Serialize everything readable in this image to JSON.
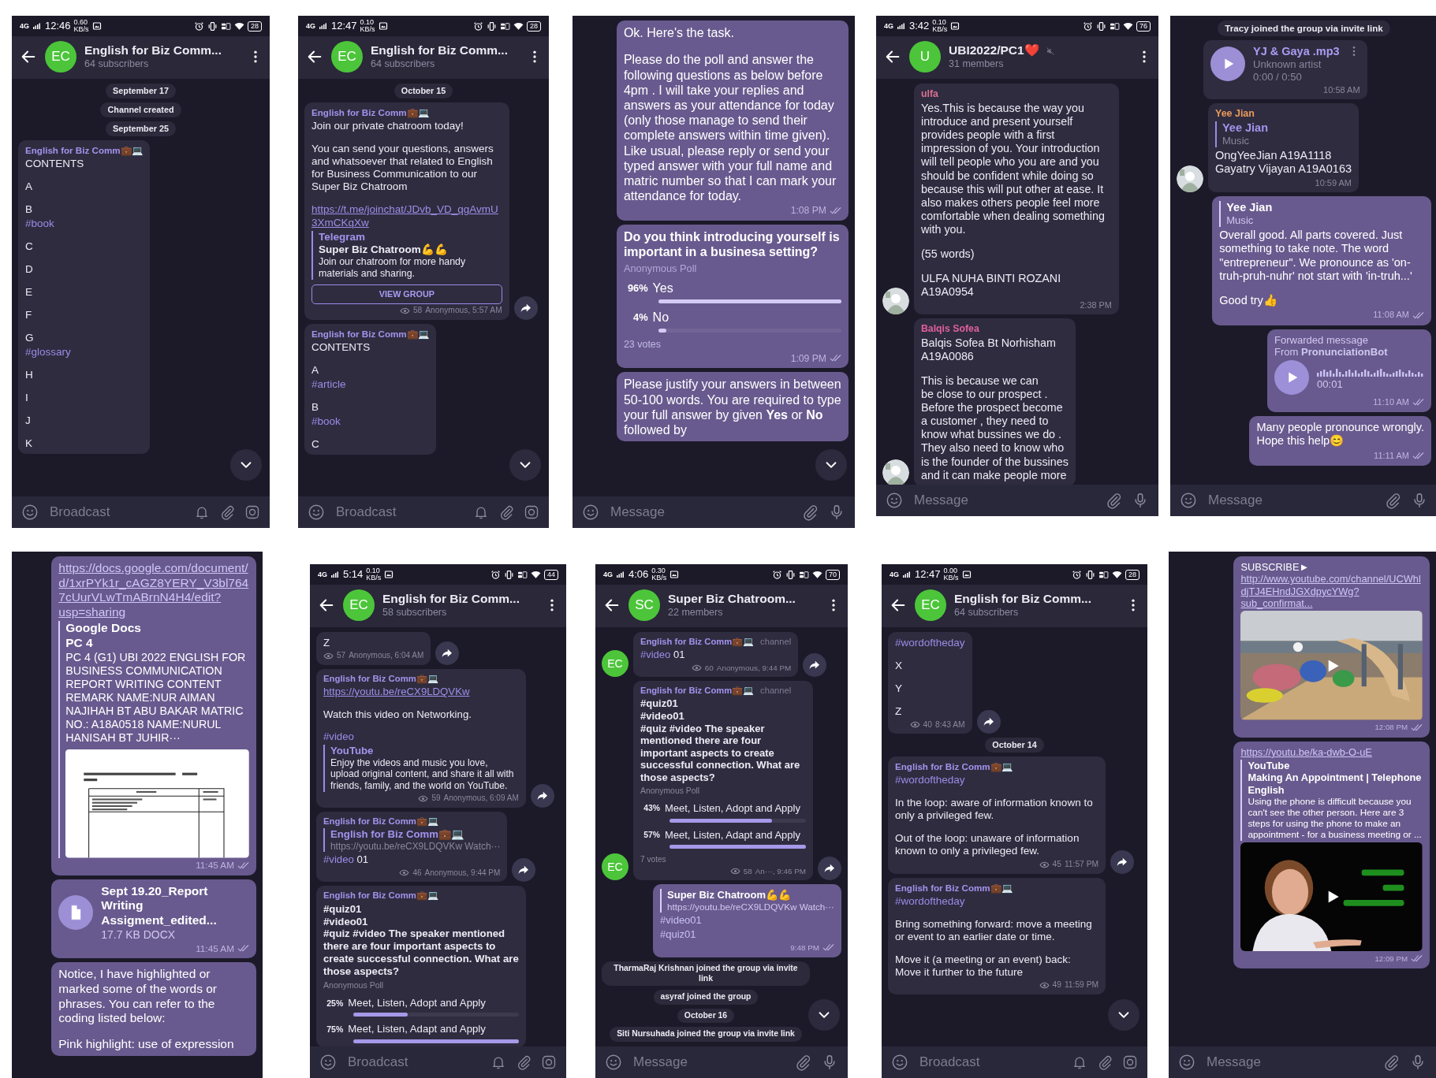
{
  "panels": [
    {
      "status_bar": {
        "network": "4G",
        "time": "12:46",
        "speed": "0.60",
        "speed_unit": "KB/s",
        "battery": "28"
      },
      "header": {
        "avatar": "EC",
        "title": "English for Biz Comm...",
        "subtitle": "64 subscribers"
      },
      "messages": [
        {
          "kind": "service",
          "text": "September 17"
        },
        {
          "kind": "service",
          "text": "Channel created"
        },
        {
          "kind": "service",
          "text": "September 25"
        },
        {
          "kind": "bubble",
          "outgoing": false,
          "author": {
            "name": "English for Biz Comm💼💻",
            "color": "#a393eb"
          },
          "blocks": [
            {
              "kind": "text",
              "text": "CONTENTS"
            },
            {
              "kind": "text",
              "text": "A"
            },
            {
              "kind": "text",
              "text": "B"
            },
            {
              "kind": "tag",
              "text": "#book",
              "joined": true
            },
            {
              "kind": "text",
              "text": "C"
            },
            {
              "kind": "text",
              "text": "D"
            },
            {
              "kind": "text",
              "text": "E"
            },
            {
              "kind": "text",
              "text": "F"
            },
            {
              "kind": "text",
              "text": "G"
            },
            {
              "kind": "tag",
              "text": "#glossary",
              "joined": true
            },
            {
              "kind": "text",
              "text": "H"
            },
            {
              "kind": "text",
              "text": "I"
            },
            {
              "kind": "text",
              "text": "J"
            },
            {
              "kind": "text",
              "text": "K"
            }
          ]
        }
      ],
      "scroll_down": true,
      "composer": {
        "kind": "channel",
        "placeholder": "Broadcast"
      }
    },
    {
      "status_bar": {
        "network": "4G",
        "time": "12:47",
        "speed": "0.10",
        "speed_unit": "KB/s",
        "battery": "28"
      },
      "header": {
        "avatar": "EC",
        "title": "English for Biz Comm...",
        "subtitle": "64 subscribers"
      },
      "messages": [
        {
          "kind": "service",
          "text": "October 15"
        },
        {
          "kind": "bubble",
          "outgoing": false,
          "share": true,
          "author": {
            "name": "English for Biz Comm💼💻",
            "color": "#a393eb"
          },
          "blocks": [
            {
              "kind": "text",
              "text": "Join our private chatroom today!"
            },
            {
              "kind": "text",
              "text": "You can send your questions, answers and whatsoever that related to English for Business Communication to our Super Biz Chatroom"
            },
            {
              "kind": "link",
              "text": "https://t.me/joinchat/JDvb_VD_qgAvmU3XmCKqXw"
            },
            {
              "kind": "preview",
              "site": "Telegram",
              "title": "Super Biz Chatroom💪💪",
              "text": "Join our chatroom for more handy materials and sharing.",
              "joined": true
            },
            {
              "kind": "button",
              "text": "VIEW GROUP",
              "joined": true
            }
          ],
          "meta": {
            "views": "58",
            "text": "Anonymous, 5:57 AM"
          }
        },
        {
          "kind": "bubble",
          "outgoing": false,
          "author": {
            "name": "English for Biz Comm💼💻",
            "color": "#a393eb"
          },
          "blocks": [
            {
              "kind": "text",
              "text": "CONTENTS"
            },
            {
              "kind": "text",
              "text": "A"
            },
            {
              "kind": "tag",
              "text": "#article",
              "joined": true
            },
            {
              "kind": "text",
              "text": "B"
            },
            {
              "kind": "tag",
              "text": "#book",
              "joined": true
            },
            {
              "kind": "text",
              "text": "C"
            }
          ]
        }
      ],
      "scroll_down": true,
      "composer": {
        "kind": "channel",
        "placeholder": "Broadcast"
      }
    },
    {
      "messages": [
        {
          "kind": "bubble",
          "outgoing": true,
          "blocks": [
            {
              "kind": "text",
              "text": "Ok. Here's the task."
            },
            {
              "kind": "text",
              "text": "Please do the poll and answer the following questions as below before 4pm . I will take your replies and answers as your attendance for today (only those manage to send their complete answers within time given). Like usual, please reply or send your typed answer with your full name and matric number so that I can mark your attendance for today."
            }
          ],
          "meta": {
            "text": "1:08 PM",
            "read": true
          }
        },
        {
          "kind": "bubble",
          "outgoing": true,
          "blocks": [
            {
              "kind": "poll",
              "question": "Do you think introducing yourself is important in a businesa setting?",
              "type": "Anonymous Poll",
              "options": [
                {
                  "percent": "96%",
                  "label": "Yes",
                  "level": 1
                },
                {
                  "percent": "4%",
                  "label": "No",
                  "level": 0.04
                }
              ],
              "votes": "23 votes"
            }
          ],
          "meta": {
            "text": "1:09 PM",
            "read": true
          }
        },
        {
          "kind": "bubble",
          "outgoing": true,
          "blocks": [
            {
              "kind": "text",
              "text": "Please justify your answers in between 50-100 words. You are required to type your full answer by given **Yes** or **No** followed by"
            }
          ]
        }
      ],
      "scroll_down": true,
      "composer": {
        "kind": "group",
        "placeholder": "Message"
      }
    },
    {
      "status_bar": {
        "network": "4G",
        "time": "3:42",
        "speed": "0.10",
        "speed_unit": "KB/s",
        "battery": "76"
      },
      "header": {
        "avatar": "U",
        "title": "UBI2022/PC1❤️",
        "subtitle": "31 members",
        "muted": true
      },
      "messages": [
        {
          "kind": "bubble",
          "outgoing": false,
          "avatar": {
            "kind": "picture"
          },
          "author": {
            "name": "ulfa",
            "color": "#d9708f"
          },
          "blocks": [
            {
              "kind": "text",
              "text": "Yes.This is because the way you introduce and present yourself provides people with a first impression of you. Your introduction will tell people who you are and you should be confident while doing so because this will put other at ease. It also makes others people feel more comfortable when dealing something with you."
            },
            {
              "kind": "text",
              "text": "(55 words)"
            },
            {
              "kind": "text",
              "text": "ULFA NUHA BINTI ROZANI\nA19A0954"
            }
          ],
          "meta": {
            "text": "2:38 PM"
          }
        },
        {
          "kind": "bubble",
          "outgoing": false,
          "avatar": {
            "kind": "picture"
          },
          "author": {
            "name": "Balqis Sofea",
            "color": "#e0609a"
          },
          "blocks": [
            {
              "kind": "text",
              "text": "Balqis Sofea Bt Norhisham\nA19A0086"
            },
            {
              "kind": "text",
              "text": "This is because we can\nbe close to our prospect .\nBefore the prospect become\na customer , they need to\nknow what bussines we do .\nThey also need to know who\nis the founder of the bussines\nand it can make people more"
            }
          ]
        }
      ],
      "composer": {
        "kind": "group",
        "placeholder": "Message"
      }
    },
    {
      "messages": [
        {
          "kind": "service",
          "text": "Tracy joined the group via invite link"
        },
        {
          "kind": "bubble",
          "outgoing": false,
          "indent": true,
          "blocks": [
            {
              "kind": "audio",
              "title": "YJ & Gaya .mp3",
              "performer": "Unknown artist",
              "duration": "0:00 / 0:50"
            }
          ],
          "meta": {
            "text": "10:58 AM"
          }
        },
        {
          "kind": "bubble",
          "outgoing": false,
          "avatar": {
            "kind": "picture"
          },
          "author": {
            "name": "Yee Jian",
            "color": "#e89a5a"
          },
          "blocks": [
            {
              "kind": "reply",
              "author": "Yee Jian",
              "text": "Music"
            },
            {
              "kind": "text",
              "text": "OngYeeJian  A19A1118\nGayatry Vijayan A19A0163",
              "joined": true
            }
          ],
          "meta": {
            "text": "10:59 AM"
          }
        },
        {
          "kind": "bubble",
          "outgoing": true,
          "blocks": [
            {
              "kind": "reply",
              "author": "Yee Jian",
              "text": "Music"
            },
            {
              "kind": "text",
              "text": "Overall good. All parts covered. Just something to take note. The word \"entrepreneur\". We pronounce as 'on-truh-pruh-nuhr' not start with 'in-truh...'",
              "joined": true
            },
            {
              "kind": "text",
              "text": "Good try👍"
            }
          ],
          "meta": {
            "text": "11:08 AM",
            "read": true
          }
        },
        {
          "kind": "bubble",
          "outgoing": true,
          "blocks": [
            {
              "kind": "forward",
              "label": "Forwarded message",
              "from": "From **PronunciationBot**"
            },
            {
              "kind": "voice",
              "duration": "00:01",
              "joined": true
            }
          ],
          "meta": {
            "text": "11:10 AM",
            "read": true
          }
        },
        {
          "kind": "bubble",
          "outgoing": true,
          "blocks": [
            {
              "kind": "text",
              "text": "Many people pronounce wrongly.\nHope this help😊"
            }
          ],
          "meta": {
            "text": "11:11 AM",
            "read": true
          }
        }
      ],
      "composer": {
        "kind": "group",
        "placeholder": "Message"
      }
    },
    {
      "messages": [
        {
          "kind": "bubble",
          "outgoing": true,
          "blocks": [
            {
              "kind": "link",
              "text": "https://docs.google.com/document/d/1xrPYk1r_cAGZ8YERY_V3bl7647cUurVLwTmABrnN4H4/edit?usp=sharing"
            },
            {
              "kind": "preview",
              "site": "Google Docs",
              "title": "PC 4",
              "text": "PC 4 (G1)      UBI 2022 ENGLISH FOR BUSINESS COMMUNICATION REPORT WRITING  CONTENT REMARK NAME:NUR AIMAN NAJIHAH BT ABU BAKAR MATRIC NO.: A18A0518 NAME:NURUL HANISAH BT JUHIR···",
              "document": true,
              "joined": true
            }
          ],
          "meta": {
            "text": "11:45 AM",
            "read": true
          }
        },
        {
          "kind": "bubble",
          "outgoing": true,
          "blocks": [
            {
              "kind": "file",
              "name": "Sept 19.20_Report Writing Assigment_edited...",
              "size": "17.7 KB DOCX"
            }
          ],
          "meta": {
            "text": "11:45 AM",
            "read": true
          }
        },
        {
          "kind": "bubble",
          "outgoing": true,
          "blocks": [
            {
              "kind": "text",
              "text": "Notice, I have highlighted or marked some of the words or phrases. You can refer to the coding listed below:"
            },
            {
              "kind": "text",
              "text": "Pink highlight: use of expression"
            }
          ]
        }
      ]
    },
    {
      "status_bar": {
        "network": "4G",
        "time": "5:14",
        "speed": "0.10",
        "speed_unit": "KB/s",
        "battery": "44"
      },
      "header": {
        "avatar": "EC",
        "title": "English for Biz Comm...",
        "subtitle": "58 subscribers"
      },
      "messages": [
        {
          "kind": "bubble",
          "outgoing": false,
          "share": true,
          "blocks": [
            {
              "kind": "text",
              "text": "Z"
            }
          ],
          "meta": {
            "views": "57",
            "text": "Anonymous, 6:04 AM"
          }
        },
        {
          "kind": "bubble",
          "outgoing": false,
          "share": true,
          "author": {
            "name": "English for Biz Comm💼💻",
            "color": "#a393eb"
          },
          "blocks": [
            {
              "kind": "link",
              "text": "https://youtu.be/reCX9LDQVKw",
              "joined": true
            },
            {
              "kind": "text",
              "text": "Watch this video on Networking."
            },
            {
              "kind": "tag",
              "text": "#video"
            },
            {
              "kind": "preview",
              "site": "YouTube",
              "text": "Enjoy the videos and music you love, upload original content, and share it all with friends, family, and the world on YouTube.",
              "joined": true
            }
          ],
          "meta": {
            "views": "59",
            "text": "Anonymous, 6:09 AM"
          }
        },
        {
          "kind": "bubble",
          "outgoing": false,
          "share": true,
          "author": {
            "name": "English for Biz Comm💼💻",
            "color": "#a393eb"
          },
          "blocks": [
            {
              "kind": "reply",
              "author": "English for Biz Comm💼💻",
              "text": "https://youtu.be/reCX9LDQVKw  Watch···"
            },
            {
              "kind": "tag",
              "text": "#video",
              "rest": " 01",
              "joined": true
            }
          ],
          "meta": {
            "views": "46",
            "text": "Anonymous, 9:44 PM"
          }
        },
        {
          "kind": "bubble",
          "outgoing": false,
          "author": {
            "name": "English for Biz Comm💼💻",
            "color": "#a393eb"
          },
          "blocks": [
            {
              "kind": "poll",
              "question": "#quiz01\n#video01\n#quiz #video  The speaker mentioned there are four important aspects to create successful connection. What are those aspects?",
              "type": "Anonymous Poll",
              "options": [
                {
                  "percent": "25%",
                  "label": "Meet, Listen, Adopt and Apply",
                  "level": 0.33
                },
                {
                  "percent": "75%",
                  "label": "Meet, Listen, Adapt and Apply",
                  "level": 1
                }
              ]
            }
          ]
        }
      ],
      "composer": {
        "kind": "channel",
        "placeholder": "Broadcast"
      }
    },
    {
      "status_bar": {
        "network": "4G",
        "time": "4:06",
        "speed": "0.30",
        "speed_unit": "KB/s",
        "battery": "70"
      },
      "header": {
        "avatar": "SC",
        "title": "Super Biz Chatroom...",
        "subtitle": "22 members"
      },
      "messages": [
        {
          "kind": "bubble",
          "outgoing": false,
          "share": true,
          "avatar": {
            "kind": "initials",
            "text": "EC"
          },
          "author": {
            "name": "English for Biz Comm💼💻",
            "color": "#a393eb"
          },
          "author_label": "channel",
          "blocks": [
            {
              "kind": "tag",
              "text": "#video",
              "rest": " 01",
              "joined": true
            }
          ],
          "meta": {
            "views": "60",
            "text": "Anonymous, 9:44 PM"
          }
        },
        {
          "kind": "bubble",
          "outgoing": false,
          "share": true,
          "avatar": {
            "kind": "initials",
            "text": "EC"
          },
          "author": {
            "name": "English for Biz Comm💼💻",
            "color": "#a393eb"
          },
          "author_label": "channel",
          "blocks": [
            {
              "kind": "poll",
              "question": "#quiz01\n#video01\n#quiz #video  The speaker mentioned there are four important aspects to create successful connection. What are those aspects?",
              "type": "Anonymous Poll",
              "options": [
                {
                  "percent": "43%",
                  "label": "Meet, Listen, Adopt and Apply",
                  "level": 0.75
                },
                {
                  "percent": "57%",
                  "label": "Meet, Listen, Adapt and Apply",
                  "level": 1
                }
              ],
              "votes": "7 votes"
            }
          ],
          "meta": {
            "views": "58",
            "text": "An···, 9:46 PM"
          }
        },
        {
          "kind": "bubble",
          "outgoing": true,
          "blocks": [
            {
              "kind": "reply",
              "author": "Super Biz Chatroom💪💪",
              "text": "https://youtu.be/reCX9LDQVKw  Watch···"
            },
            {
              "kind": "tag",
              "text": "#video01",
              "joined": true
            },
            {
              "kind": "tag",
              "text": "#quiz01",
              "joined": true
            }
          ],
          "meta": {
            "text": "9:48 PM",
            "read": true
          }
        },
        {
          "kind": "service",
          "text": "TharmaRaj Krishnan joined the group via invite link"
        },
        {
          "kind": "service",
          "text": "asyraf joined the group"
        },
        {
          "kind": "service",
          "text": "October 16"
        },
        {
          "kind": "service",
          "text": "Siti Nursuhada joined the group via invite link"
        }
      ],
      "scroll_down": true,
      "composer": {
        "kind": "group",
        "placeholder": "Message"
      }
    },
    {
      "status_bar": {
        "network": "4G",
        "time": "12:47",
        "speed": "0.00",
        "speed_unit": "KB/s",
        "battery": "28"
      },
      "header": {
        "avatar": "EC",
        "title": "English for Biz Comm...",
        "subtitle": "64 subscribers"
      },
      "messages": [
        {
          "kind": "bubble",
          "outgoing": false,
          "share": true,
          "blocks": [
            {
              "kind": "tag",
              "text": "#wordoftheday"
            },
            {
              "kind": "text",
              "text": "X"
            },
            {
              "kind": "text",
              "text": "Y"
            },
            {
              "kind": "text",
              "text": "Z"
            }
          ],
          "meta": {
            "views": "40",
            "text": "8:43 AM"
          }
        },
        {
          "kind": "service",
          "text": "October 14"
        },
        {
          "kind": "bubble",
          "outgoing": false,
          "share": true,
          "author": {
            "name": "English for Biz Comm💼💻",
            "color": "#a393eb"
          },
          "blocks": [
            {
              "kind": "tag",
              "text": "#wordoftheday",
              "joined": true
            },
            {
              "kind": "text",
              "text": "In the loop: aware of information known to only a privileged few."
            },
            {
              "kind": "text",
              "text": "Out of the loop: unaware of information known to only a privileged few."
            }
          ],
          "meta": {
            "views": "45",
            "text": "11:57 PM"
          }
        },
        {
          "kind": "bubble",
          "outgoing": false,
          "author": {
            "name": "English for Biz Comm💼💻",
            "color": "#a393eb"
          },
          "blocks": [
            {
              "kind": "tag",
              "text": "#wordoftheday",
              "joined": true
            },
            {
              "kind": "text",
              "text": "Bring something forward: move a meeting or event to an earlier date or time."
            },
            {
              "kind": "text",
              "text": "Move it (a meeting or an event) back:\nMove it further to the future"
            }
          ],
          "meta": {
            "views": "49",
            "text": "11:59 PM"
          }
        }
      ],
      "scroll_down": true,
      "composer": {
        "kind": "channel",
        "placeholder": "Broadcast"
      }
    },
    {
      "messages": [
        {
          "kind": "bubble",
          "outgoing": true,
          "indent": true,
          "blocks": [
            {
              "kind": "textlink",
              "text": "SUBSCRIBE► ",
              "link": "http://www.youtube.com/channel/UCWhldjTJ4EHndJGXdpycYWg?sub_confirmat..."
            },
            {
              "kind": "video",
              "joined": true
            }
          ],
          "meta": {
            "text": "12:08 PM",
            "read": true
          }
        },
        {
          "kind": "bubble",
          "outgoing": true,
          "indent": true,
          "blocks": [
            {
              "kind": "link",
              "text": "https://youtu.be/ka-dwb-O-uE"
            },
            {
              "kind": "preview",
              "site": "YouTube",
              "title": "Making An Appointment | Telephone English",
              "text": "Using the phone is difficult because you can't see the other person. Here are 3 steps for using the phone to make an appointment - for a business meeting or ...",
              "joined": true
            },
            {
              "kind": "video",
              "joined": true
            }
          ],
          "meta": {
            "text": "12:09 PM",
            "read": true
          }
        }
      ],
      "composer": {
        "kind": "group",
        "placeholder": "Message"
      }
    }
  ]
}
